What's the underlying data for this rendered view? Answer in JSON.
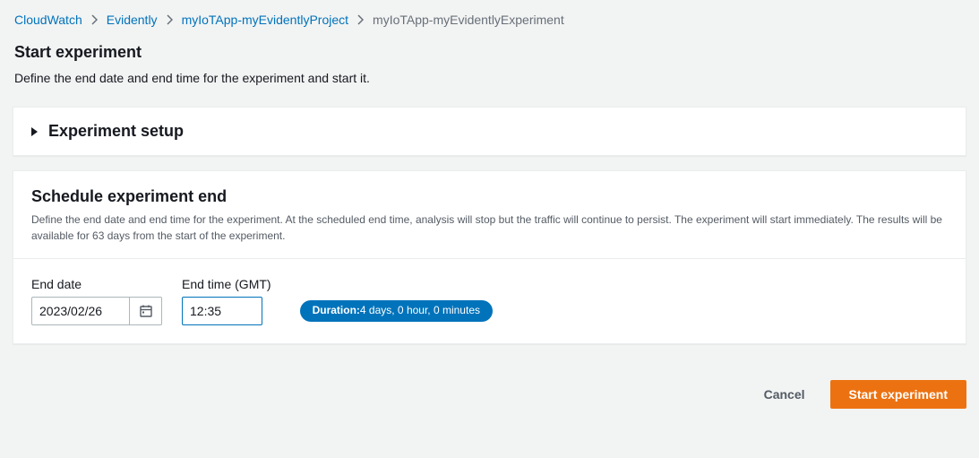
{
  "breadcrumb": {
    "items": [
      {
        "label": "CloudWatch",
        "link": true
      },
      {
        "label": "Evidently",
        "link": true
      },
      {
        "label": "myIoTApp-myEvidentlyProject",
        "link": true
      },
      {
        "label": "myIoTApp-myEvidentlyExperiment",
        "link": false
      }
    ]
  },
  "header": {
    "title": "Start experiment",
    "description": "Define the end date and end time for the experiment and start it."
  },
  "setup_panel": {
    "title": "Experiment setup"
  },
  "schedule_panel": {
    "title": "Schedule experiment end",
    "description": "Define the end date and end time for the experiment. At the scheduled end time, analysis will stop but the traffic will continue to persist. The experiment will start immediately. The results will be available for 63 days from the start of the experiment.",
    "end_date_label": "End date",
    "end_date_value": "2023/02/26",
    "end_time_label": "End time (GMT)",
    "end_time_value": "12:35",
    "duration_label": "Duration:",
    "duration_value": "4 days, 0 hour, 0 minutes"
  },
  "footer": {
    "cancel": "Cancel",
    "start": "Start experiment"
  }
}
